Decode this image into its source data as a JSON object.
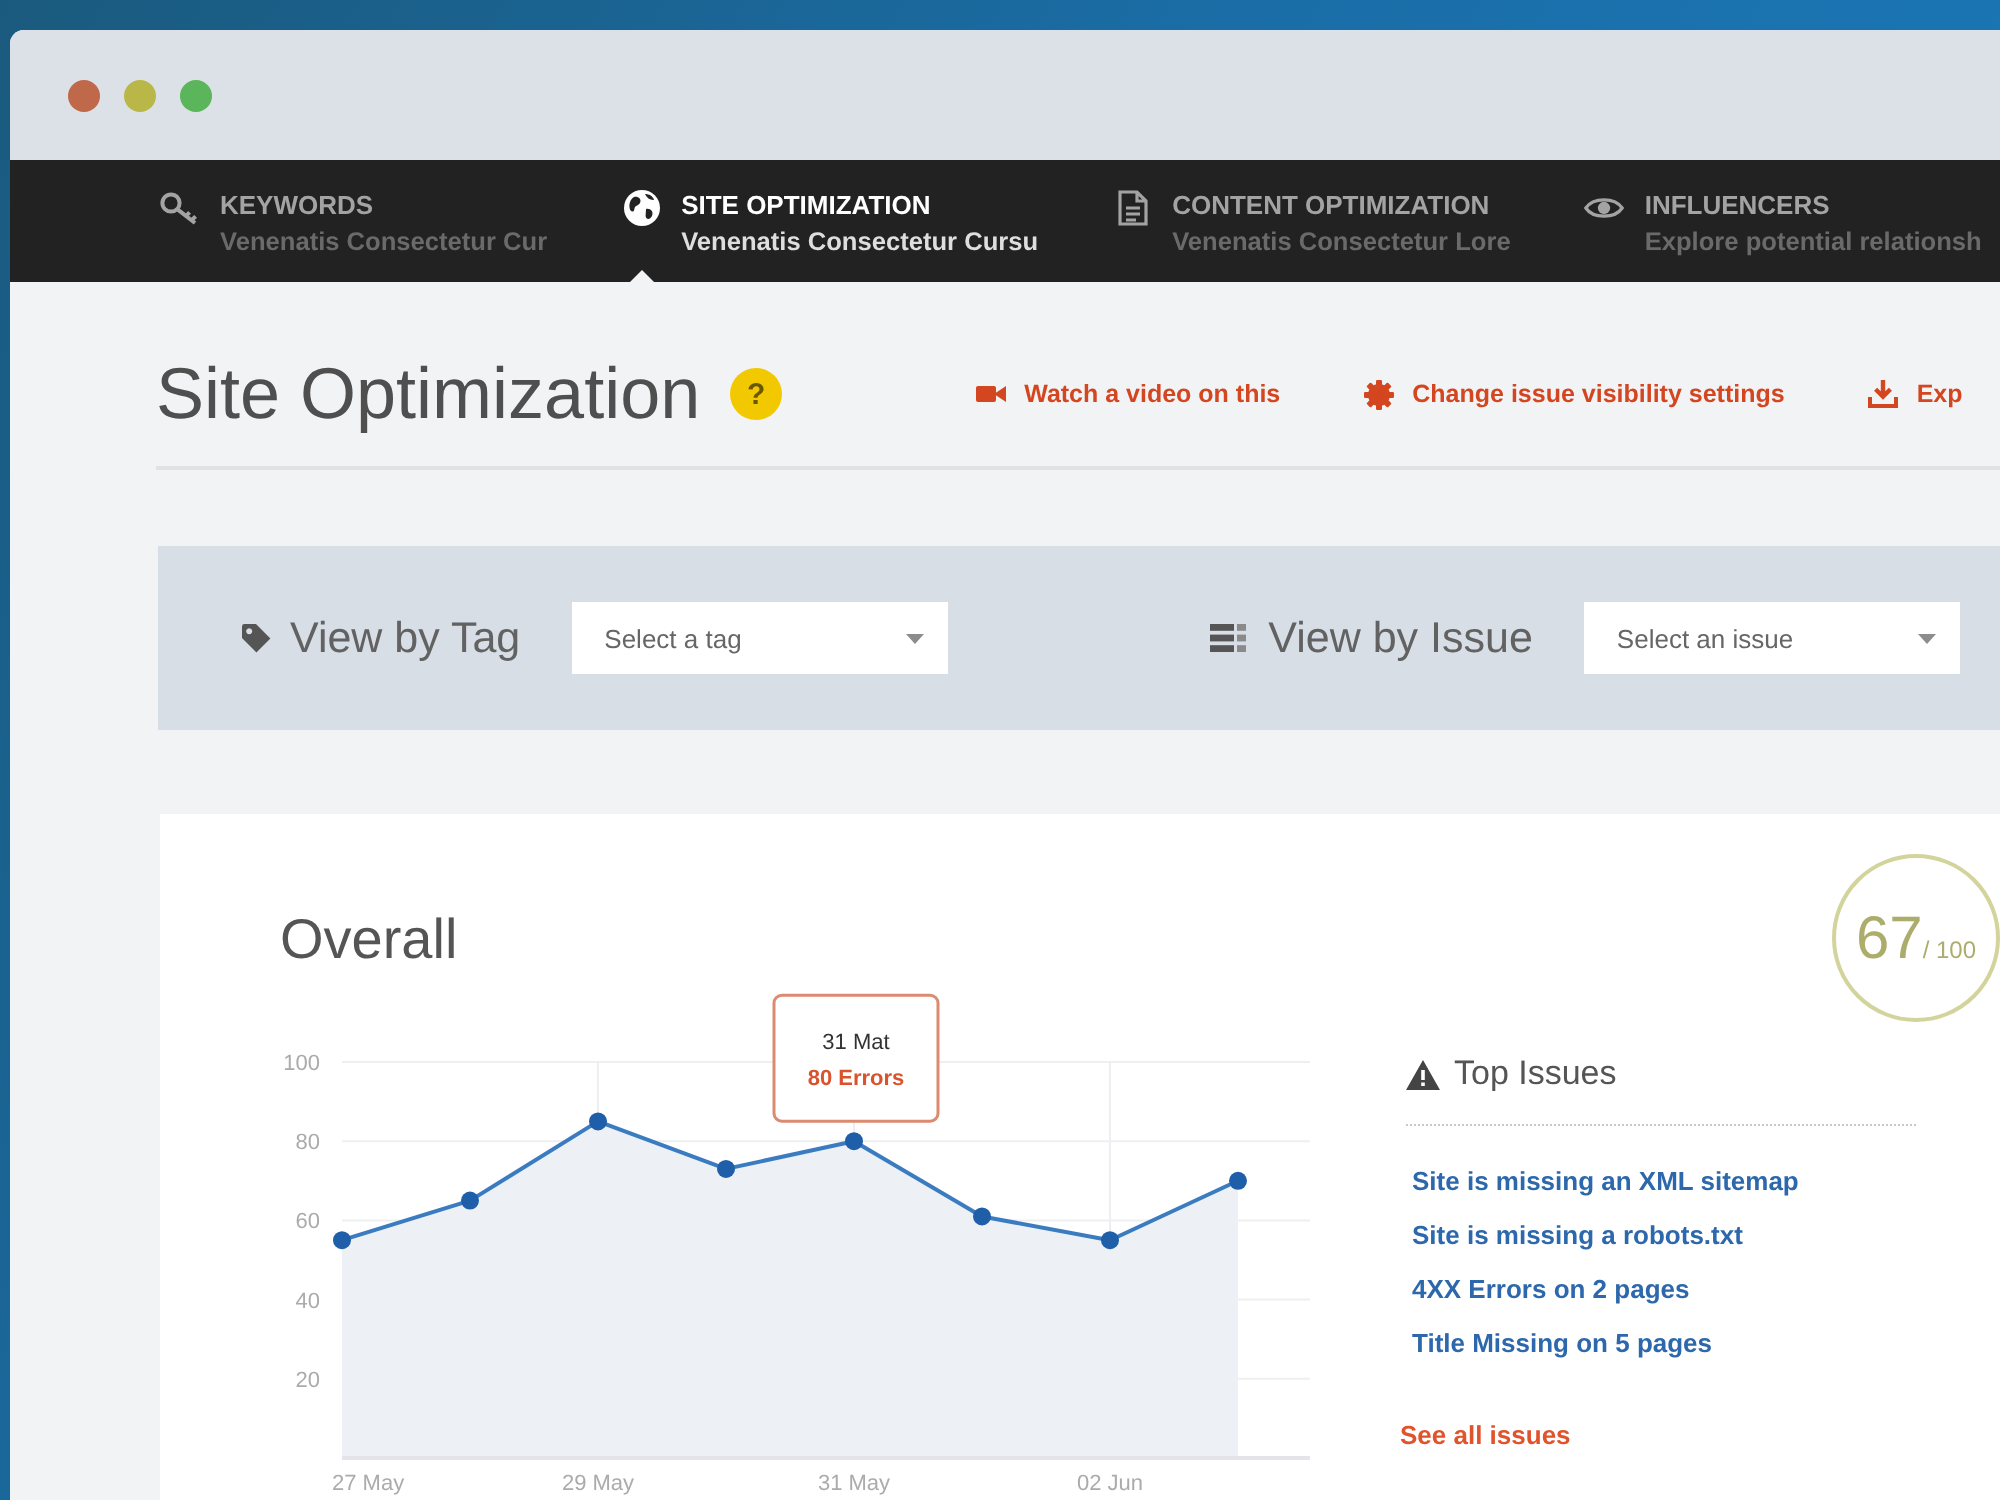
{
  "nav": {
    "tabs": [
      {
        "title": "KEYWORDS",
        "subtitle": "Venenatis Consectetur Cur",
        "selected": false
      },
      {
        "title": "SITE OPTIMIZATION",
        "subtitle": "Venenatis Consectetur Cursu",
        "selected": true
      },
      {
        "title": "CONTENT OPTIMIZATION",
        "subtitle": "Venenatis Consectetur Lore",
        "selected": false
      },
      {
        "title": "INFLUENCERS",
        "subtitle": "Explore potential relationsh",
        "selected": false
      }
    ]
  },
  "header": {
    "title": "Site Optimization",
    "help": "?",
    "links": [
      "Watch a video on this",
      "Change issue visibility settings",
      "Exp"
    ]
  },
  "filters": [
    {
      "label": "View by Tag",
      "placeholder": "Select a tag"
    },
    {
      "label": "View by Issue",
      "placeholder": "Select an issue"
    }
  ],
  "overview": {
    "title": "Overall",
    "score": {
      "value": "67",
      "max": "/ 100"
    },
    "chart_data": {
      "type": "area",
      "categories": [
        "27 May",
        null,
        "29 May",
        null,
        "31 May",
        null,
        "02 Jun",
        null
      ],
      "values": [
        55,
        65,
        85,
        73,
        80,
        61,
        55,
        70
      ],
      "ylim": [
        0,
        100
      ],
      "yticks": [
        20,
        40,
        60,
        80,
        100
      ],
      "grid": true,
      "annotations": [
        {
          "x": "31 May",
          "y": 80,
          "text": "31 Mat\n80 Errors"
        }
      ]
    },
    "top_issues": {
      "title": "Top Issues",
      "items": [
        "Site is missing an XML sitemap",
        "Site is missing a robots.txt",
        "4XX Errors on 2 pages",
        "Title Missing on 5 pages"
      ],
      "see_all": "See all issues"
    }
  }
}
